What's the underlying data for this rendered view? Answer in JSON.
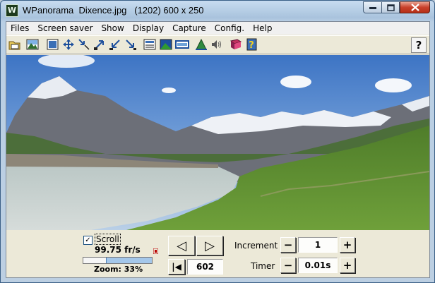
{
  "window": {
    "title": "WPanorama  Dixence.jpg   (1202) 600 x 250",
    "app_icon_glyph": "W"
  },
  "menu": [
    "Files",
    "Screen saver",
    "Show",
    "Display",
    "Capture",
    "Config.",
    "Help"
  ],
  "toolbar": {
    "icons": [
      "open-file-icon",
      "picture-icon",
      "fullscreen-icon",
      "resize-icon",
      "shrink-icon",
      "expand-diagonal-icon",
      "collapse-diagonal-icon",
      "arrow-down-right-icon",
      "image-frame-icon",
      "landscape-icon",
      "panorama-icon",
      "tent-icon",
      "speaker-icon",
      "book-icon",
      "help-book-icon"
    ],
    "help_label": "?"
  },
  "scroll": {
    "label": "Scroll",
    "checked": true,
    "check_glyph": "✓",
    "fps": "99.75 fr/s",
    "zoom_label": "Zoom: 33%",
    "zoom_percent": 33
  },
  "navigation": {
    "prev_glyph": "◁",
    "next_glyph": "▷",
    "first_glyph": "|◀",
    "position": "602"
  },
  "increment": {
    "label": "Increment",
    "value": "1",
    "minus": "−",
    "plus": "+"
  },
  "timer": {
    "label": "Timer",
    "value": "0.01s",
    "minus": "−",
    "plus": "+"
  },
  "colors": {
    "sky": "#5e8fd6",
    "lake": "#c9d2ce",
    "grass": "#5a8a2f"
  }
}
